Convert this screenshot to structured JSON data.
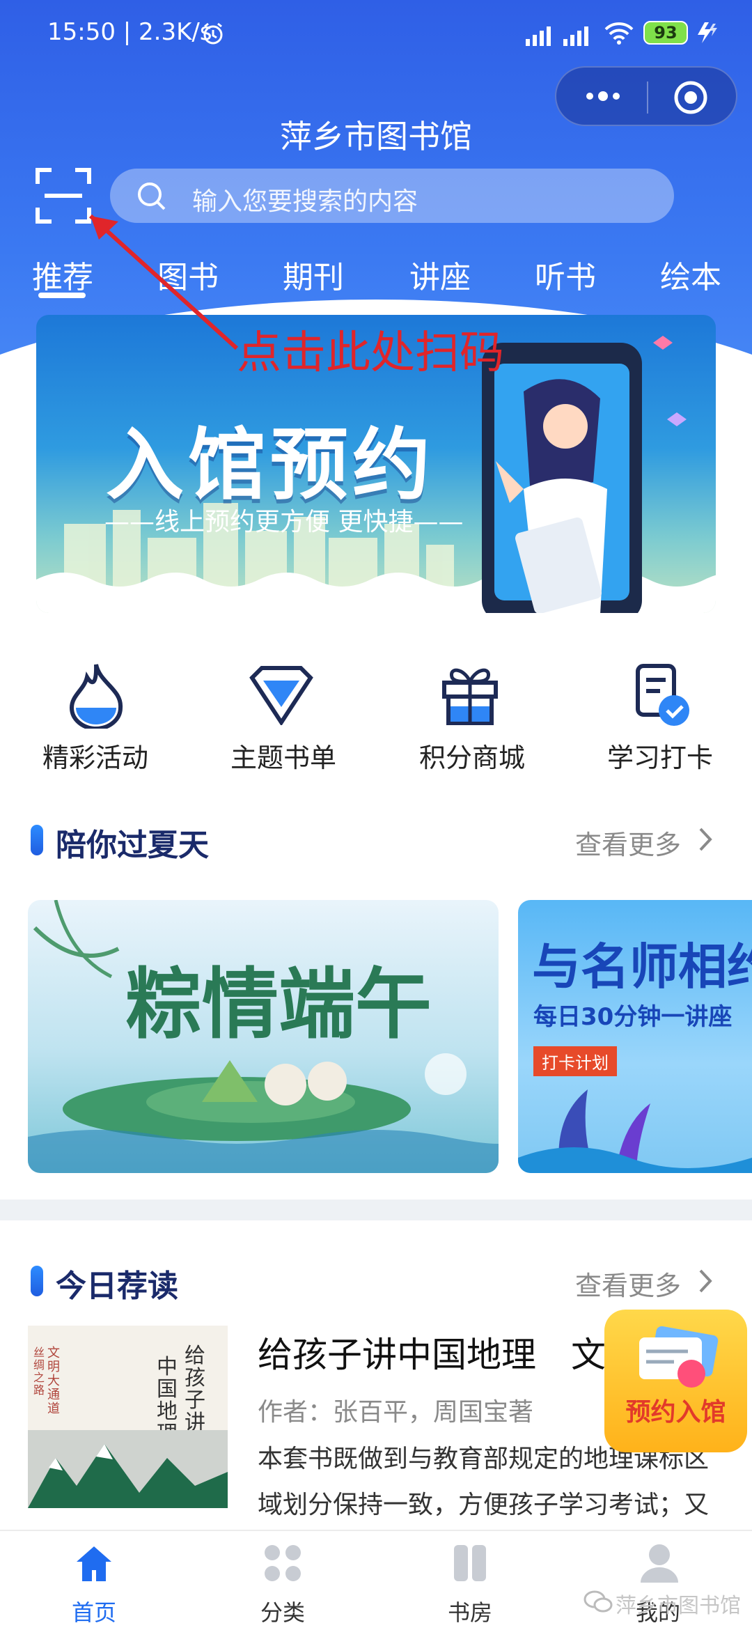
{
  "status_bar": {
    "time_speed": "15:50 | 2.3K/s",
    "battery": "93"
  },
  "header": {
    "title": "萍乡市图书馆",
    "search_placeholder": "输入您要搜索的内容"
  },
  "tabs": [
    "推荐",
    "图书",
    "期刊",
    "讲座",
    "听书",
    "绘本"
  ],
  "annotation": "点击此处扫码",
  "banner": {
    "title": "入馆预约",
    "subtitle": "——线上预约更方便 更快捷——"
  },
  "quick_actions": [
    {
      "label": "精彩活动",
      "icon": "flame-icon"
    },
    {
      "label": "主题书单",
      "icon": "diamond-icon"
    },
    {
      "label": "积分商城",
      "icon": "gift-icon"
    },
    {
      "label": "学习打卡",
      "icon": "checklist-icon"
    }
  ],
  "section_summer": {
    "title": "陪你过夏天",
    "more": "查看更多",
    "cards": [
      {
        "title": "粽情端午"
      },
      {
        "title": "与名师相约",
        "subtitle": "每日30分钟一讲座",
        "tag": "打卡计划"
      }
    ]
  },
  "section_reading": {
    "title": "今日荐读",
    "more": "查看更多",
    "book": {
      "title": "给孩子讲中国地理",
      "title_extra": "文",
      "author": "作者：张百平，周国宝著",
      "description": "本套书既做到与教育部规定的地理课标区域划分保持一致，方便孩子学习考试；又增加趣味",
      "cover_lines": [
        "给孩子讲",
        "中国地理"
      ],
      "cover_side": [
        "文明大通道",
        "丝绸之路"
      ]
    }
  },
  "float_badge": "预约入馆",
  "bottom_nav": [
    {
      "label": "首页",
      "icon": "home-icon"
    },
    {
      "label": "分类",
      "icon": "grid-icon"
    },
    {
      "label": "书房",
      "icon": "bookshelf-icon"
    },
    {
      "label": "我的",
      "icon": "profile-icon"
    }
  ],
  "watermark": "萍乡市图书馆",
  "colors": {
    "primary": "#3b79f2",
    "annotation": "#e0252a",
    "tab_active": "#1f6cf0"
  }
}
